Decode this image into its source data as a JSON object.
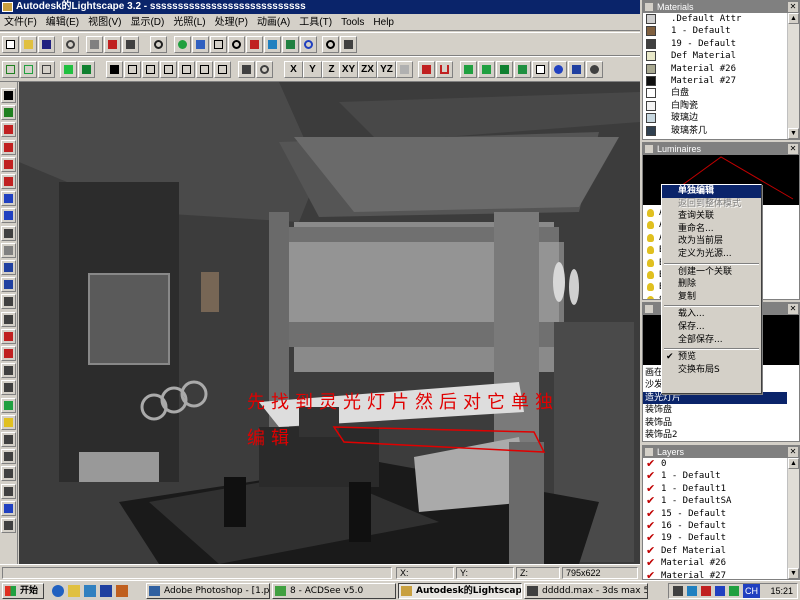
{
  "window": {
    "title": "Autodesk的Lightscape 3.2 - ssssssssssssssssssssssssssss"
  },
  "menu": [
    "文件(F)",
    "编辑(E)",
    "视图(V)",
    "显示(D)",
    "光照(L)",
    "处理(P)",
    "动画(A)",
    "工具(T)",
    "Tools",
    "Help"
  ],
  "axis_buttons": [
    "X",
    "Y",
    "Z",
    "XY",
    "ZX",
    "YZ"
  ],
  "annotation": {
    "line1": "先找到灵光灯片然后对它单独",
    "line2": "编辑",
    "color": "#e00000"
  },
  "status": {
    "field1": "X:",
    "field2": "Y:",
    "field3": "Z:",
    "size": "795x622"
  },
  "materials_panel": {
    "title": "Materials",
    "items": [
      {
        "label": ".Default Attr",
        "color": "#d0d0d0"
      },
      {
        "label": "1 - Default",
        "color": "#806040"
      },
      {
        "label": "19 - Default",
        "color": "#404040"
      },
      {
        "label": "Def Material",
        "color": "#e8e8c8"
      },
      {
        "label": "Material #26",
        "color": "#a8a890"
      },
      {
        "label": "Material #27",
        "color": "#101010"
      },
      {
        "label": "白盘",
        "color": "#ffffff"
      },
      {
        "label": "白陶瓷",
        "color": "#f4f4f4"
      },
      {
        "label": "玻璃边",
        "color": "#c8d8e0"
      },
      {
        "label": "玻璃茶几",
        "color": "#304050"
      }
    ]
  },
  "luminaires_panel": {
    "title": "Luminaires",
    "items": [
      "A",
      "A",
      "A",
      "B",
      "B",
      "B",
      "B",
      "S"
    ]
  },
  "context_menu": {
    "items": [
      {
        "label": "单独编辑",
        "state": "selected"
      },
      {
        "label": "返回到整体模式",
        "state": "disabled"
      },
      {
        "label": "查询关联",
        "state": "normal"
      },
      {
        "label": "重命名...",
        "state": "normal"
      },
      {
        "label": "改为当前层",
        "state": "normal"
      },
      {
        "label": "定义为光源...",
        "state": "normal"
      },
      {
        "label": "sep"
      },
      {
        "label": "创建一个关联",
        "state": "normal"
      },
      {
        "label": "删除",
        "state": "normal"
      },
      {
        "label": "复制",
        "state": "normal"
      },
      {
        "label": "sep"
      },
      {
        "label": "载入...",
        "state": "normal"
      },
      {
        "label": "保存...",
        "state": "normal"
      },
      {
        "label": "全部保存...",
        "state": "normal"
      },
      {
        "label": "sep"
      },
      {
        "label": "预览",
        "state": "checked"
      },
      {
        "label": "交换布局S",
        "state": "normal"
      }
    ]
  },
  "blocks_panel": {
    "items": [
      "画在",
      "沙发",
      "造光灯片",
      "装饰盘",
      "装饰品",
      "装饰品2"
    ]
  },
  "layers_panel": {
    "title": "Layers",
    "items": [
      "0",
      "1 - Default",
      "1 - Default1",
      "1 - DefaultSA",
      "15 - Default",
      "16 - Default",
      "19 - Default",
      "Def Material",
      "Material #26",
      "Material #27"
    ]
  },
  "taskbar": {
    "start": "开始",
    "tasks": [
      {
        "label": "Adobe Photoshop - [1.ps..."
      },
      {
        "label": "8 - ACDSee v5.0"
      },
      {
        "label": "Autodesk的Lightscape 3..."
      },
      {
        "label": "ddddd.max - 3ds max 5 -..."
      }
    ],
    "tray": {
      "ime": "CH",
      "clock": "15:21"
    }
  }
}
